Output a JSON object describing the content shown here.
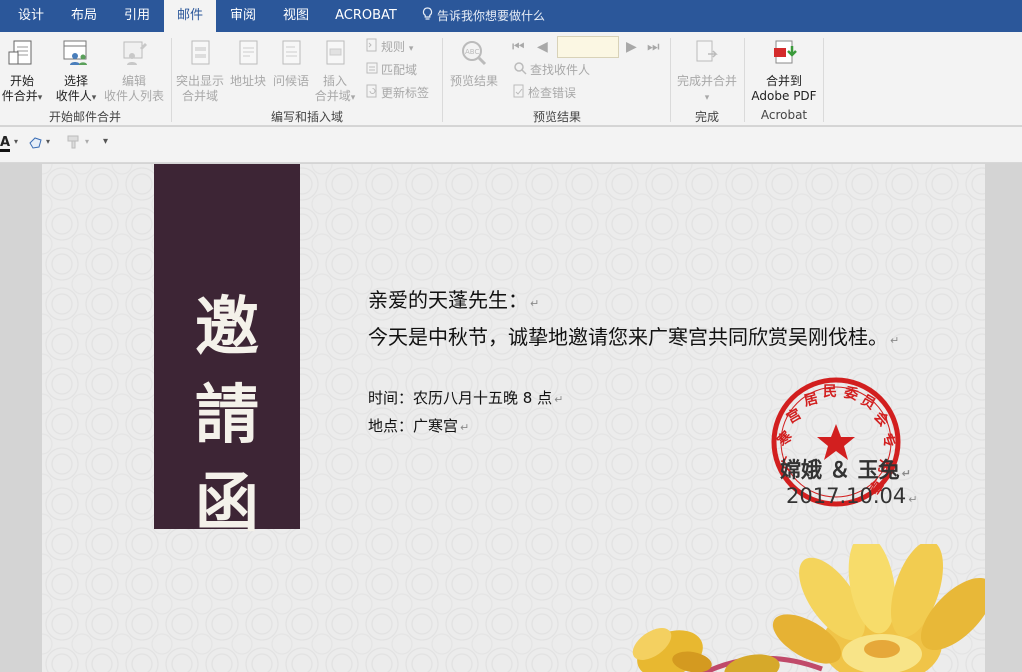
{
  "tabs": [
    "设计",
    "布局",
    "引用",
    "邮件",
    "审阅",
    "视图",
    "ACROBAT"
  ],
  "active_tab": "邮件",
  "tell_me": "告诉我你想要做什么",
  "ribbon": {
    "start": {
      "start_line1": "开始",
      "start_line2": "件合并",
      "select_line1": "选择",
      "select_line2": "收件人",
      "edit_line1": "编辑",
      "edit_line2": "收件人列表",
      "group": "开始邮件合并"
    },
    "write": {
      "highlight_line1": "突出显示",
      "highlight_line2": "合并域",
      "address": "地址块",
      "greeting": "问候语",
      "insert_line1": "插入",
      "insert_line2": "合并域",
      "rules": "规则",
      "match": "匹配域",
      "update": "更新标签",
      "group": "编写和插入域"
    },
    "preview": {
      "preview_results": "预览结果",
      "find": "查找收件人",
      "check": "检查错误",
      "group": "预览结果"
    },
    "finish": {
      "finish_merge": "完成并合并",
      "group": "完成"
    },
    "acrobat": {
      "line1": "合并到",
      "line2": "Adobe PDF",
      "group": "Acrobat"
    }
  },
  "document": {
    "banner_chars": [
      "邀",
      "請",
      "函"
    ],
    "greeting": "亲爱的天蓬先生：",
    "body": "今天是中秋节，诚挚地邀请您来广寒宫共同欣赏吴刚伐桂。",
    "time": "时间：农历八月十五晚 8 点",
    "place": "地点：广寒宫",
    "signature": "嫦娥 ＆ 玉兔",
    "date": "2017.10.04",
    "stamp_text": "广寒宫居民委员会专用章",
    "paragraph_mark": "↵"
  },
  "colors": {
    "tabbar": "#2b579a",
    "ribbon": "#f3f3f3",
    "banner": "#3d2535",
    "stamp": "#d21f1f"
  }
}
